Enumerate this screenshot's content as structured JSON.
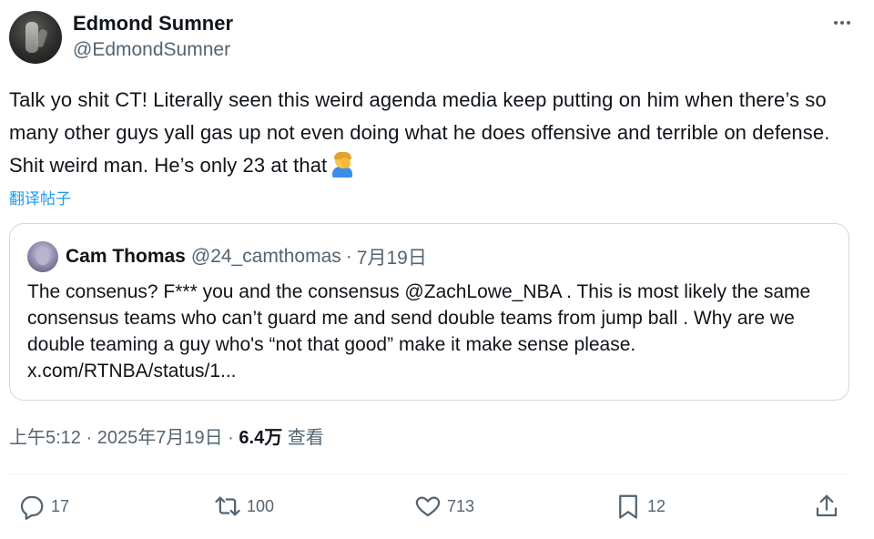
{
  "author": {
    "display_name": "Edmond Sumner",
    "handle": "@EdmondSumner"
  },
  "tweet": {
    "text": "Talk yo shit CT! Literally seen this weird agenda media keep putting on him when there’s so many other guys yall gas up not even doing what he does offensive and terrible on defense. Shit weird man. He’s only 23 at that",
    "emoji": "person-facepalming-emoji",
    "translate_label": "翻译帖子"
  },
  "quote": {
    "display_name": "Cam Thomas",
    "handle": "@24_camthomas",
    "separator": "·",
    "date": "7月19日",
    "text": "The consenus? F*** you and the consensus @ZachLowe_NBA . This is most likely the same consensus teams who can’t guard me and send double teams from jump ball . Why are we double teaming a guy who's “not that good” make it make sense please. x.com/RTNBA/status/1..."
  },
  "meta": {
    "time": "上午5:12",
    "separator": "·",
    "date": "2025年7月19日",
    "views_count": "6.4万",
    "views_label": "查看"
  },
  "actions": {
    "reply_icon": "reply-icon",
    "reply_count": "17",
    "retweet_icon": "retweet-icon",
    "retweet_count": "100",
    "like_icon": "heart-icon",
    "like_count": "713",
    "bookmark_icon": "bookmark-icon",
    "bookmark_count": "12",
    "share_icon": "share-icon"
  },
  "colors": {
    "text": "#0f1419",
    "secondary": "#536471",
    "link": "#1d9bf0",
    "border": "#cfd9de"
  }
}
